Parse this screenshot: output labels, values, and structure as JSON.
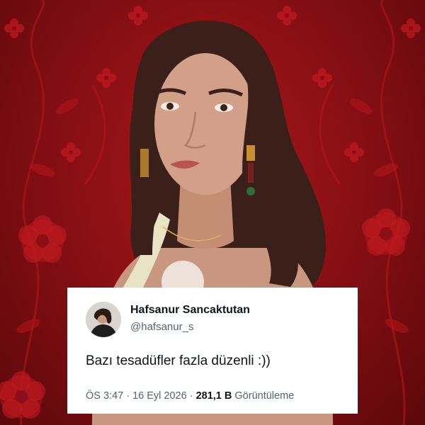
{
  "tweet": {
    "author_name": "Hafsanur Sancaktutan",
    "author_handle": "@hafsanur_s",
    "text": "Bazı tesadüfler fazla düzenli :))",
    "time": "ÖS 3:47",
    "date": "16 Eyl 2026",
    "separator": " · ",
    "views_count": "281,1 B",
    "views_label": "Görüntüleme"
  },
  "colors": {
    "wallpaper_red": "#8a1014",
    "flower_red": "#b3161c",
    "card_background": "#ffffff",
    "text_primary": "#0f1419",
    "text_secondary": "#536471"
  },
  "icons": {
    "avatar": "profile-photo"
  }
}
